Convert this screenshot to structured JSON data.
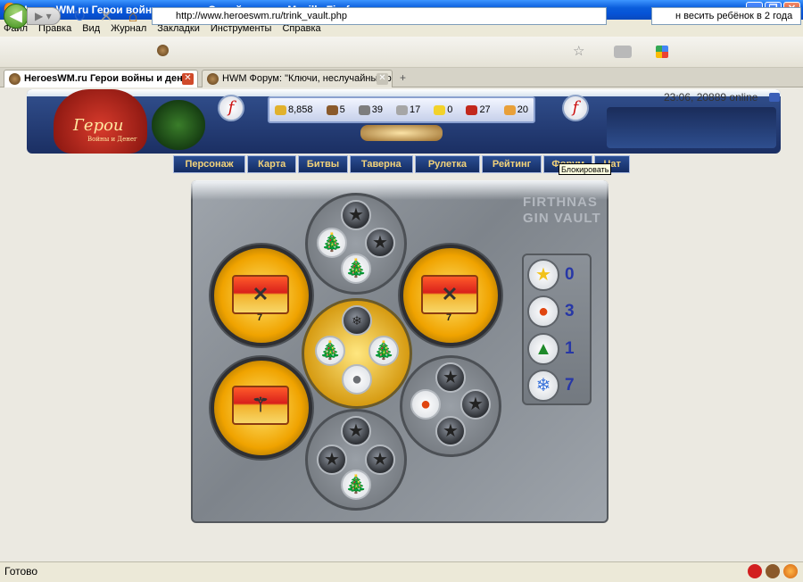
{
  "window": {
    "title": "HeroesWM.ru Герои войны и денег. Онлайн игра. - Mozilla Firefox",
    "min": "_",
    "max": "❐",
    "close": "✕"
  },
  "menu": [
    "Файл",
    "Правка",
    "Вид",
    "Журнал",
    "Закладки",
    "Инструменты",
    "Справка"
  ],
  "nav": {
    "url": "http://www.heroeswm.ru/trink_vault.php",
    "search": "н весить ребёнок в 2 года",
    "back": "◀",
    "forward": "▶ ▾",
    "reload": "↻",
    "stop": "✕",
    "home": "⌂",
    "bookmark": "☆"
  },
  "tabs": [
    {
      "label": "HeroesWM.ru Герои войны и ден...",
      "active": true
    },
    {
      "label": "HWM Форум: \"Ключи, неслучайный р...",
      "active": false
    }
  ],
  "newtab": "+",
  "header": {
    "clock": "23:06, 20889 online",
    "logo": "Герои",
    "logo_sub": "Войны и Денег",
    "flash": "f",
    "resources": [
      {
        "name": "gold",
        "value": "8,858",
        "color": "#e1b12c"
      },
      {
        "name": "wood",
        "value": "5",
        "color": "#8a5a2b"
      },
      {
        "name": "ore",
        "value": "39",
        "color": "#7d7d7d"
      },
      {
        "name": "mercury",
        "value": "17",
        "color": "#a6a6a6"
      },
      {
        "name": "sulfur",
        "value": "0",
        "color": "#f2d22a"
      },
      {
        "name": "crystals",
        "value": "27",
        "color": "#c2281c"
      },
      {
        "name": "gems",
        "value": "20",
        "color": "#e8a03a"
      }
    ],
    "menu": [
      "Персонаж",
      "Карта",
      "Битвы",
      "Таверна",
      "Рулетка",
      "Рейтинг",
      "Форум",
      "Чат"
    ]
  },
  "tooltip": "Блокировать",
  "vault": {
    "logo_line1": "FIRTHNAS",
    "logo_line2": "GIN VAULT",
    "chest_levels": [
      "7",
      "7"
    ],
    "chest_left_glyph": "✕",
    "chest_right_glyph": "✕",
    "chest_staff_glyph": "⚚",
    "star_glyph": "★",
    "tree_glyph": "🎄",
    "pumpkin_glyph": "●",
    "snow_glyph": "❄",
    "counters": [
      {
        "icon": "star-icon",
        "glyph": "★",
        "value": "0",
        "color": "#f2c21a"
      },
      {
        "icon": "pumpkin-icon",
        "glyph": "●",
        "value": "3",
        "color": "#e0450f"
      },
      {
        "icon": "tree-icon",
        "glyph": "▲",
        "value": "1",
        "color": "#1f8a2a"
      },
      {
        "icon": "snowflake-icon",
        "glyph": "❄",
        "value": "7",
        "color": "#3a73d9"
      }
    ]
  },
  "status": "Готово"
}
